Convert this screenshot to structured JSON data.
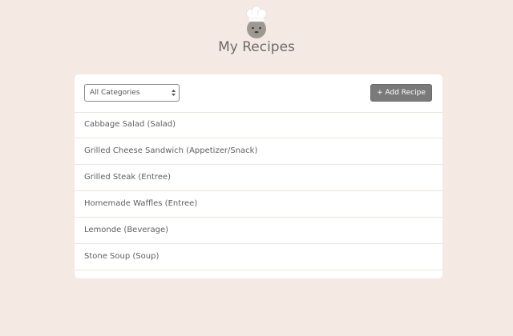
{
  "header": {
    "title": "My Recipes",
    "logo_icon": "chef-icon"
  },
  "toolbar": {
    "category_select": {
      "selected": "All Categories"
    },
    "add_button_label": "+ Add Recipe"
  },
  "recipes": [
    {
      "label": "Cabbage Salad (Salad)"
    },
    {
      "label": "Grilled Cheese Sandwich (Appetizer/Snack)"
    },
    {
      "label": "Grilled Steak (Entree)"
    },
    {
      "label": "Homemade Waffles (Entree)"
    },
    {
      "label": "Lemonde (Beverage)"
    },
    {
      "label": "Stone Soup (Soup)"
    }
  ],
  "colors": {
    "background": "#f5e9e4",
    "card": "#ffffff",
    "button": "#7a7a7a"
  }
}
